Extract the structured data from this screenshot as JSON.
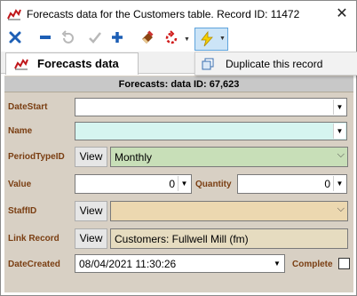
{
  "window": {
    "title": "Forecasts data for the Customers table. Record ID: 11472",
    "close_glyph": "✕"
  },
  "toolbar": {
    "icons": [
      "close-x-icon",
      "delete-minus-icon",
      "undo-icon",
      "save-check-icon",
      "add-plus-icon",
      "eraser-icon",
      "refresh-icon",
      "lightning-icon"
    ]
  },
  "tab": {
    "label": "Forecasts data"
  },
  "menu": {
    "item": "Duplicate this record"
  },
  "form": {
    "header": "Forecasts: data ID: 67,623",
    "fields": {
      "date_start": {
        "label": "DateStart",
        "value": ""
      },
      "name": {
        "label": "Name",
        "value": ""
      },
      "period_type": {
        "label": "PeriodTypeID",
        "view": "View",
        "value": "Monthly"
      },
      "value": {
        "label": "Value",
        "value": "0"
      },
      "quantity": {
        "label": "Quantity",
        "value": "0"
      },
      "staff": {
        "label": "StaffID",
        "view": "View",
        "value": ""
      },
      "link_record": {
        "label": "Link Record",
        "view": "View",
        "value": "Customers: Fullwell Mill (fm)"
      },
      "date_created": {
        "label": "DateCreated",
        "value": "08/04/2021 11:30:26"
      },
      "complete": {
        "label": "Complete",
        "checked": false
      }
    }
  },
  "colors": {
    "label": "#7a3e12",
    "name_bg": "#d6f5f0",
    "period_bg": "#c8dfb8",
    "staff_bg": "#ecd8b0",
    "link_bg": "#e6dcc0",
    "form_bg": "#d8d0c4",
    "highlight": "#cce4f7"
  }
}
